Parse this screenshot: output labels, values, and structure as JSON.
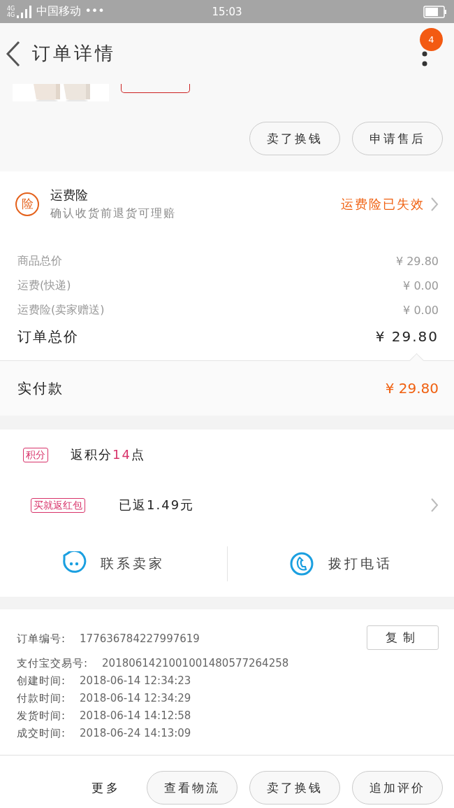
{
  "status_bar": {
    "network": [
      "4G",
      "4G"
    ],
    "carrier": "中国移动 •••",
    "time": "15:03"
  },
  "header": {
    "title": "订单详情",
    "badge": "4"
  },
  "product": {
    "actions": [
      "卖了换钱",
      "申请售后"
    ]
  },
  "insurance": {
    "badge": "险",
    "title": "运费险",
    "subtitle": "确认收货前退货可理赔",
    "status": "运费险已失效"
  },
  "price_rows": [
    {
      "label": "商品总价",
      "value": "¥ 29.80"
    },
    {
      "label": "运费(快递)",
      "value": "¥ 0.00"
    },
    {
      "label": "运费险(卖家赠送)",
      "value": "¥ 0.00"
    }
  ],
  "total": {
    "label": "订单总价",
    "value": "¥ 29.80"
  },
  "paid": {
    "label": "实付款",
    "value": "¥ 29.80"
  },
  "points": {
    "tag": "积分",
    "text_before": "返积分",
    "highlight": "14",
    "text_after": "点"
  },
  "rebate": {
    "tag": "买就返红包",
    "text": "已返1.49元"
  },
  "contact": [
    {
      "kind": "chat",
      "label": "联系卖家"
    },
    {
      "kind": "phone",
      "label": "拨打电话"
    }
  ],
  "order_info": {
    "copy_button": "复制",
    "rows": [
      {
        "label": "订单编号:",
        "value": "177636784227997619"
      },
      {
        "label": "支付宝交易号:",
        "value": "2018061421001001480577264258"
      },
      {
        "label": "创建时间:",
        "value": "2018-06-14 12:34:23"
      },
      {
        "label": "付款时间:",
        "value": "2018-06-14 12:34:29"
      },
      {
        "label": "发货时间:",
        "value": "2018-06-14 14:12:58"
      },
      {
        "label": "成交时间:",
        "value": "2018-06-24 14:13:09"
      }
    ]
  },
  "bottom_bar": {
    "more": "更多",
    "buttons": [
      "查看物流",
      "卖了换钱",
      "追加评价"
    ]
  }
}
